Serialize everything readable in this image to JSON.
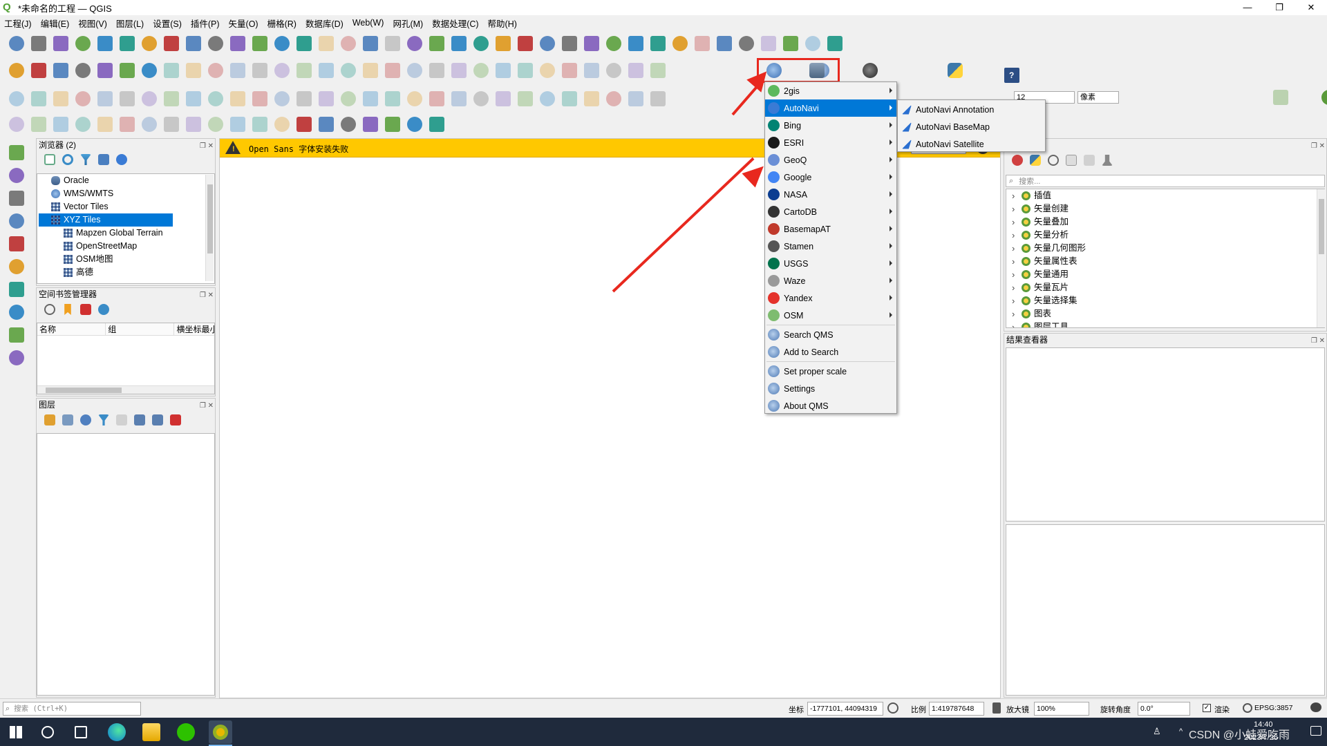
{
  "window": {
    "title": "*未命名的工程 — QGIS",
    "logo": "qgis-logo"
  },
  "menubar": [
    "工程(J)",
    "编辑(E)",
    "视图(V)",
    "图层(L)",
    "设置(S)",
    "插件(P)",
    "矢量(O)",
    "栅格(R)",
    "数据库(D)",
    "Web(W)",
    "网孔(M)",
    "数据处理(C)",
    "帮助(H)"
  ],
  "browser_panel": {
    "title": "浏览器 (2)",
    "items": [
      {
        "label": "Oracle",
        "icon": "oracle-db-icon",
        "indent": 0
      },
      {
        "label": "WMS/WMTS",
        "icon": "globe-icon",
        "indent": 0
      },
      {
        "label": "Vector Tiles",
        "icon": "grid-icon",
        "indent": 0
      },
      {
        "label": "XYZ Tiles",
        "icon": "grid-icon",
        "indent": 0,
        "selected": true
      },
      {
        "label": "Mapzen Global Terrain",
        "icon": "grid-icon",
        "indent": 1
      },
      {
        "label": "OpenStreetMap",
        "icon": "grid-icon",
        "indent": 1
      },
      {
        "label": "OSM地图",
        "icon": "grid-icon",
        "indent": 1
      },
      {
        "label": "高德",
        "icon": "grid-icon",
        "indent": 1
      }
    ]
  },
  "bookmark_panel": {
    "title": "空间书签管理器",
    "columns": [
      "名称",
      "组",
      "横坐标最小"
    ]
  },
  "layers_panel": {
    "title": "图层"
  },
  "message_bar": {
    "text": "Open Sans 字体安装失败",
    "icon": "warning-icon"
  },
  "qms_menu": {
    "items": [
      {
        "label": "2gis",
        "icon": "2gis-icon",
        "color": "#5cb85c",
        "sub": true
      },
      {
        "label": "AutoNavi",
        "icon": "autonavi-icon",
        "color": "#3a7bd5",
        "sub": true,
        "selected": true
      },
      {
        "label": "Bing",
        "icon": "bing-icon",
        "color": "#008373",
        "sub": true
      },
      {
        "label": "ESRI",
        "icon": "esri-icon",
        "color": "#1a1a1a",
        "sub": true
      },
      {
        "label": "GeoQ",
        "icon": "geoq-icon",
        "color": "#6b8fd6",
        "sub": true
      },
      {
        "label": "Google",
        "icon": "google-icon",
        "color": "#4285f4",
        "sub": true
      },
      {
        "label": "NASA",
        "icon": "nasa-icon",
        "color": "#0b3d91",
        "sub": true
      },
      {
        "label": "CartoDB",
        "icon": "cartodb-icon",
        "color": "#333333",
        "sub": true
      },
      {
        "label": "BasemapAT",
        "icon": "basemapat-icon",
        "color": "#c0392b",
        "sub": true
      },
      {
        "label": "Stamen",
        "icon": "stamen-icon",
        "color": "#555555",
        "sub": true
      },
      {
        "label": "USGS",
        "icon": "usgs-icon",
        "color": "#00734c",
        "sub": true
      },
      {
        "label": "Waze",
        "icon": "waze-icon",
        "color": "#999999",
        "sub": true
      },
      {
        "label": "Yandex",
        "icon": "yandex-icon",
        "color": "#e4322b",
        "sub": true
      },
      {
        "label": "OSM",
        "icon": "osm-icon",
        "color": "#7ebc6f",
        "sub": true
      }
    ],
    "actions": [
      {
        "label": "Search QMS",
        "icon": "qms-icon"
      },
      {
        "label": "Add to Search",
        "icon": "qms-icon"
      },
      {
        "label": "Set proper scale",
        "icon": "qms-icon"
      },
      {
        "label": "Settings",
        "icon": "qms-icon"
      },
      {
        "label": "About QMS",
        "icon": "qms-icon"
      }
    ]
  },
  "autonavi_submenu": [
    "AutoNavi Annotation",
    "AutoNavi BaseMap",
    "AutoNavi Satellite"
  ],
  "toolbox": {
    "search_placeholder": "搜索...",
    "items": [
      "插值",
      "矢量创建",
      "矢量叠加",
      "矢量分析",
      "矢量几何图形",
      "矢量属性表",
      "矢量通用",
      "矢量瓦片",
      "矢量选择集",
      "图表",
      "图层工具"
    ]
  },
  "results_viewer": {
    "title": "结果查看器"
  },
  "style_toolbar": {
    "size": "12",
    "unit": "像素"
  },
  "status": {
    "locator_placeholder": "搜索 (Ctrl+K)",
    "coord_label": "坐标",
    "coord_value": "-1777101, 44094319",
    "scale_label": "比例",
    "scale_value": "1:419787648",
    "magnifier_label": "放大镜",
    "magnifier_value": "100%",
    "rotation_label": "旋转角度",
    "rotation_value": "0.0°",
    "render_label": "渲染",
    "crs": "EPSG:3857"
  },
  "taskbar": {
    "time": "14:40",
    "date": "2023/7/26",
    "watermark": "CSDN @小蛙爱吃雨"
  },
  "colors": {
    "highlight": "#0078d7",
    "message": "#ffc800",
    "annotation": "#e8281e"
  }
}
